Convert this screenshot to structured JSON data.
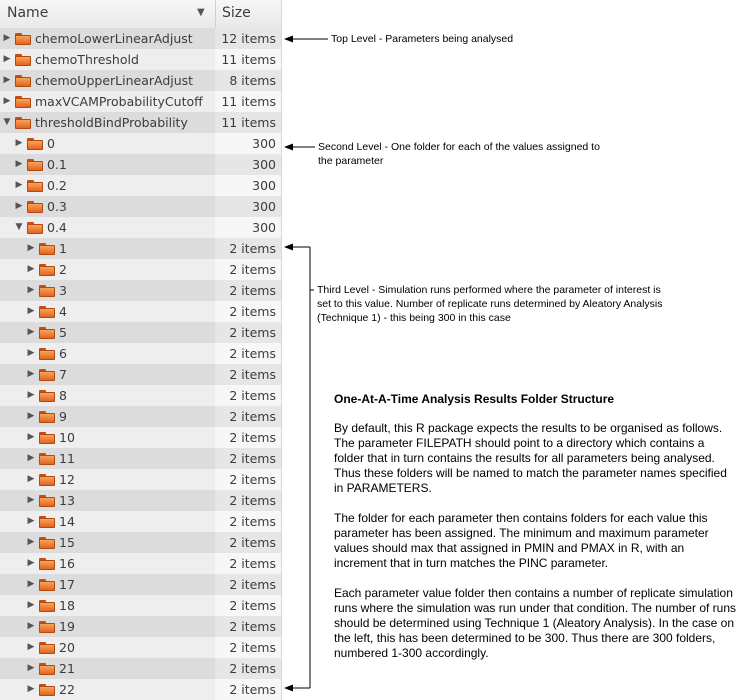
{
  "header": {
    "name": "Name",
    "size": "Size"
  },
  "rows": [
    {
      "level": 0,
      "expanded": false,
      "name": "chemoLowerLinearAdjust",
      "size": "12 items"
    },
    {
      "level": 0,
      "expanded": false,
      "name": "chemoThreshold",
      "size": "11 items"
    },
    {
      "level": 0,
      "expanded": false,
      "name": "chemoUpperLinearAdjust",
      "size": "8 items"
    },
    {
      "level": 0,
      "expanded": false,
      "name": "maxVCAMProbabilityCutoff",
      "size": "11 items"
    },
    {
      "level": 0,
      "expanded": true,
      "name": "thresholdBindProbability",
      "size": "11 items"
    },
    {
      "level": 1,
      "expanded": false,
      "name": "0",
      "size": "300 items"
    },
    {
      "level": 1,
      "expanded": false,
      "name": "0.1",
      "size": "300 items"
    },
    {
      "level": 1,
      "expanded": false,
      "name": "0.2",
      "size": "300 items"
    },
    {
      "level": 1,
      "expanded": false,
      "name": "0.3",
      "size": "300 items"
    },
    {
      "level": 1,
      "expanded": true,
      "name": "0.4",
      "size": "300 items"
    },
    {
      "level": 2,
      "expanded": false,
      "name": "1",
      "size": "2 items"
    },
    {
      "level": 2,
      "expanded": false,
      "name": "2",
      "size": "2 items"
    },
    {
      "level": 2,
      "expanded": false,
      "name": "3",
      "size": "2 items"
    },
    {
      "level": 2,
      "expanded": false,
      "name": "4",
      "size": "2 items"
    },
    {
      "level": 2,
      "expanded": false,
      "name": "5",
      "size": "2 items"
    },
    {
      "level": 2,
      "expanded": false,
      "name": "6",
      "size": "2 items"
    },
    {
      "level": 2,
      "expanded": false,
      "name": "7",
      "size": "2 items"
    },
    {
      "level": 2,
      "expanded": false,
      "name": "8",
      "size": "2 items"
    },
    {
      "level": 2,
      "expanded": false,
      "name": "9",
      "size": "2 items"
    },
    {
      "level": 2,
      "expanded": false,
      "name": "10",
      "size": "2 items"
    },
    {
      "level": 2,
      "expanded": false,
      "name": "11",
      "size": "2 items"
    },
    {
      "level": 2,
      "expanded": false,
      "name": "12",
      "size": "2 items"
    },
    {
      "level": 2,
      "expanded": false,
      "name": "13",
      "size": "2 items"
    },
    {
      "level": 2,
      "expanded": false,
      "name": "14",
      "size": "2 items"
    },
    {
      "level": 2,
      "expanded": false,
      "name": "15",
      "size": "2 items"
    },
    {
      "level": 2,
      "expanded": false,
      "name": "16",
      "size": "2 items"
    },
    {
      "level": 2,
      "expanded": false,
      "name": "17",
      "size": "2 items"
    },
    {
      "level": 2,
      "expanded": false,
      "name": "18",
      "size": "2 items"
    },
    {
      "level": 2,
      "expanded": false,
      "name": "19",
      "size": "2 items"
    },
    {
      "level": 2,
      "expanded": false,
      "name": "20",
      "size": "2 items"
    },
    {
      "level": 2,
      "expanded": false,
      "name": "21",
      "size": "2 items"
    },
    {
      "level": 2,
      "expanded": false,
      "name": "22",
      "size": "2 items"
    }
  ],
  "annotations": {
    "top_level": "Top Level - Parameters being analysed",
    "second_level_1": "Second Level - One folder for each of the values assigned to",
    "second_level_2": "the parameter",
    "third_level_1": "Third Level - Simulation runs performed where the parameter of interest is",
    "third_level_2": "set to this value.  Number of replicate runs determined by Aleatory Analysis",
    "third_level_3": "(Technique 1) - this being 300 in this case"
  },
  "info": {
    "title": "One-At-A-Time Analysis Results Folder Structure",
    "p1": "By default, this R package expects the results to be organised as follows. The parameter FILEPATH should point to a directory which contains a folder that in turn contains the results for all parameters being analysed. Thus these folders will be named to match the parameter names specified in PARAMETERS.",
    "p2": "The folder for each parameter then contains folders for each value this parameter has been assigned. The minimum and maximum parameter values should max that assigned in PMIN and PMAX in R, with an increment that in turn matches the PINC parameter.",
    "p3": "Each parameter value folder then contains a number of replicate simulation runs where the simulation was run under that condition.  The number of runs should be determined using Technique 1 (Aleatory Analysis).  In the case on the left, this has been determined to be 300. Thus there are 300 folders, numbered 1-300 accordingly."
  },
  "colors": {
    "folder": "#e1641f",
    "row_odd": "#dcdcdc",
    "row_even": "#eeeeee"
  },
  "icons": {
    "folder": "folder-icon",
    "collapsed": "triangle-right-icon",
    "expanded": "triangle-down-icon",
    "sort": "sort-descending-icon"
  }
}
